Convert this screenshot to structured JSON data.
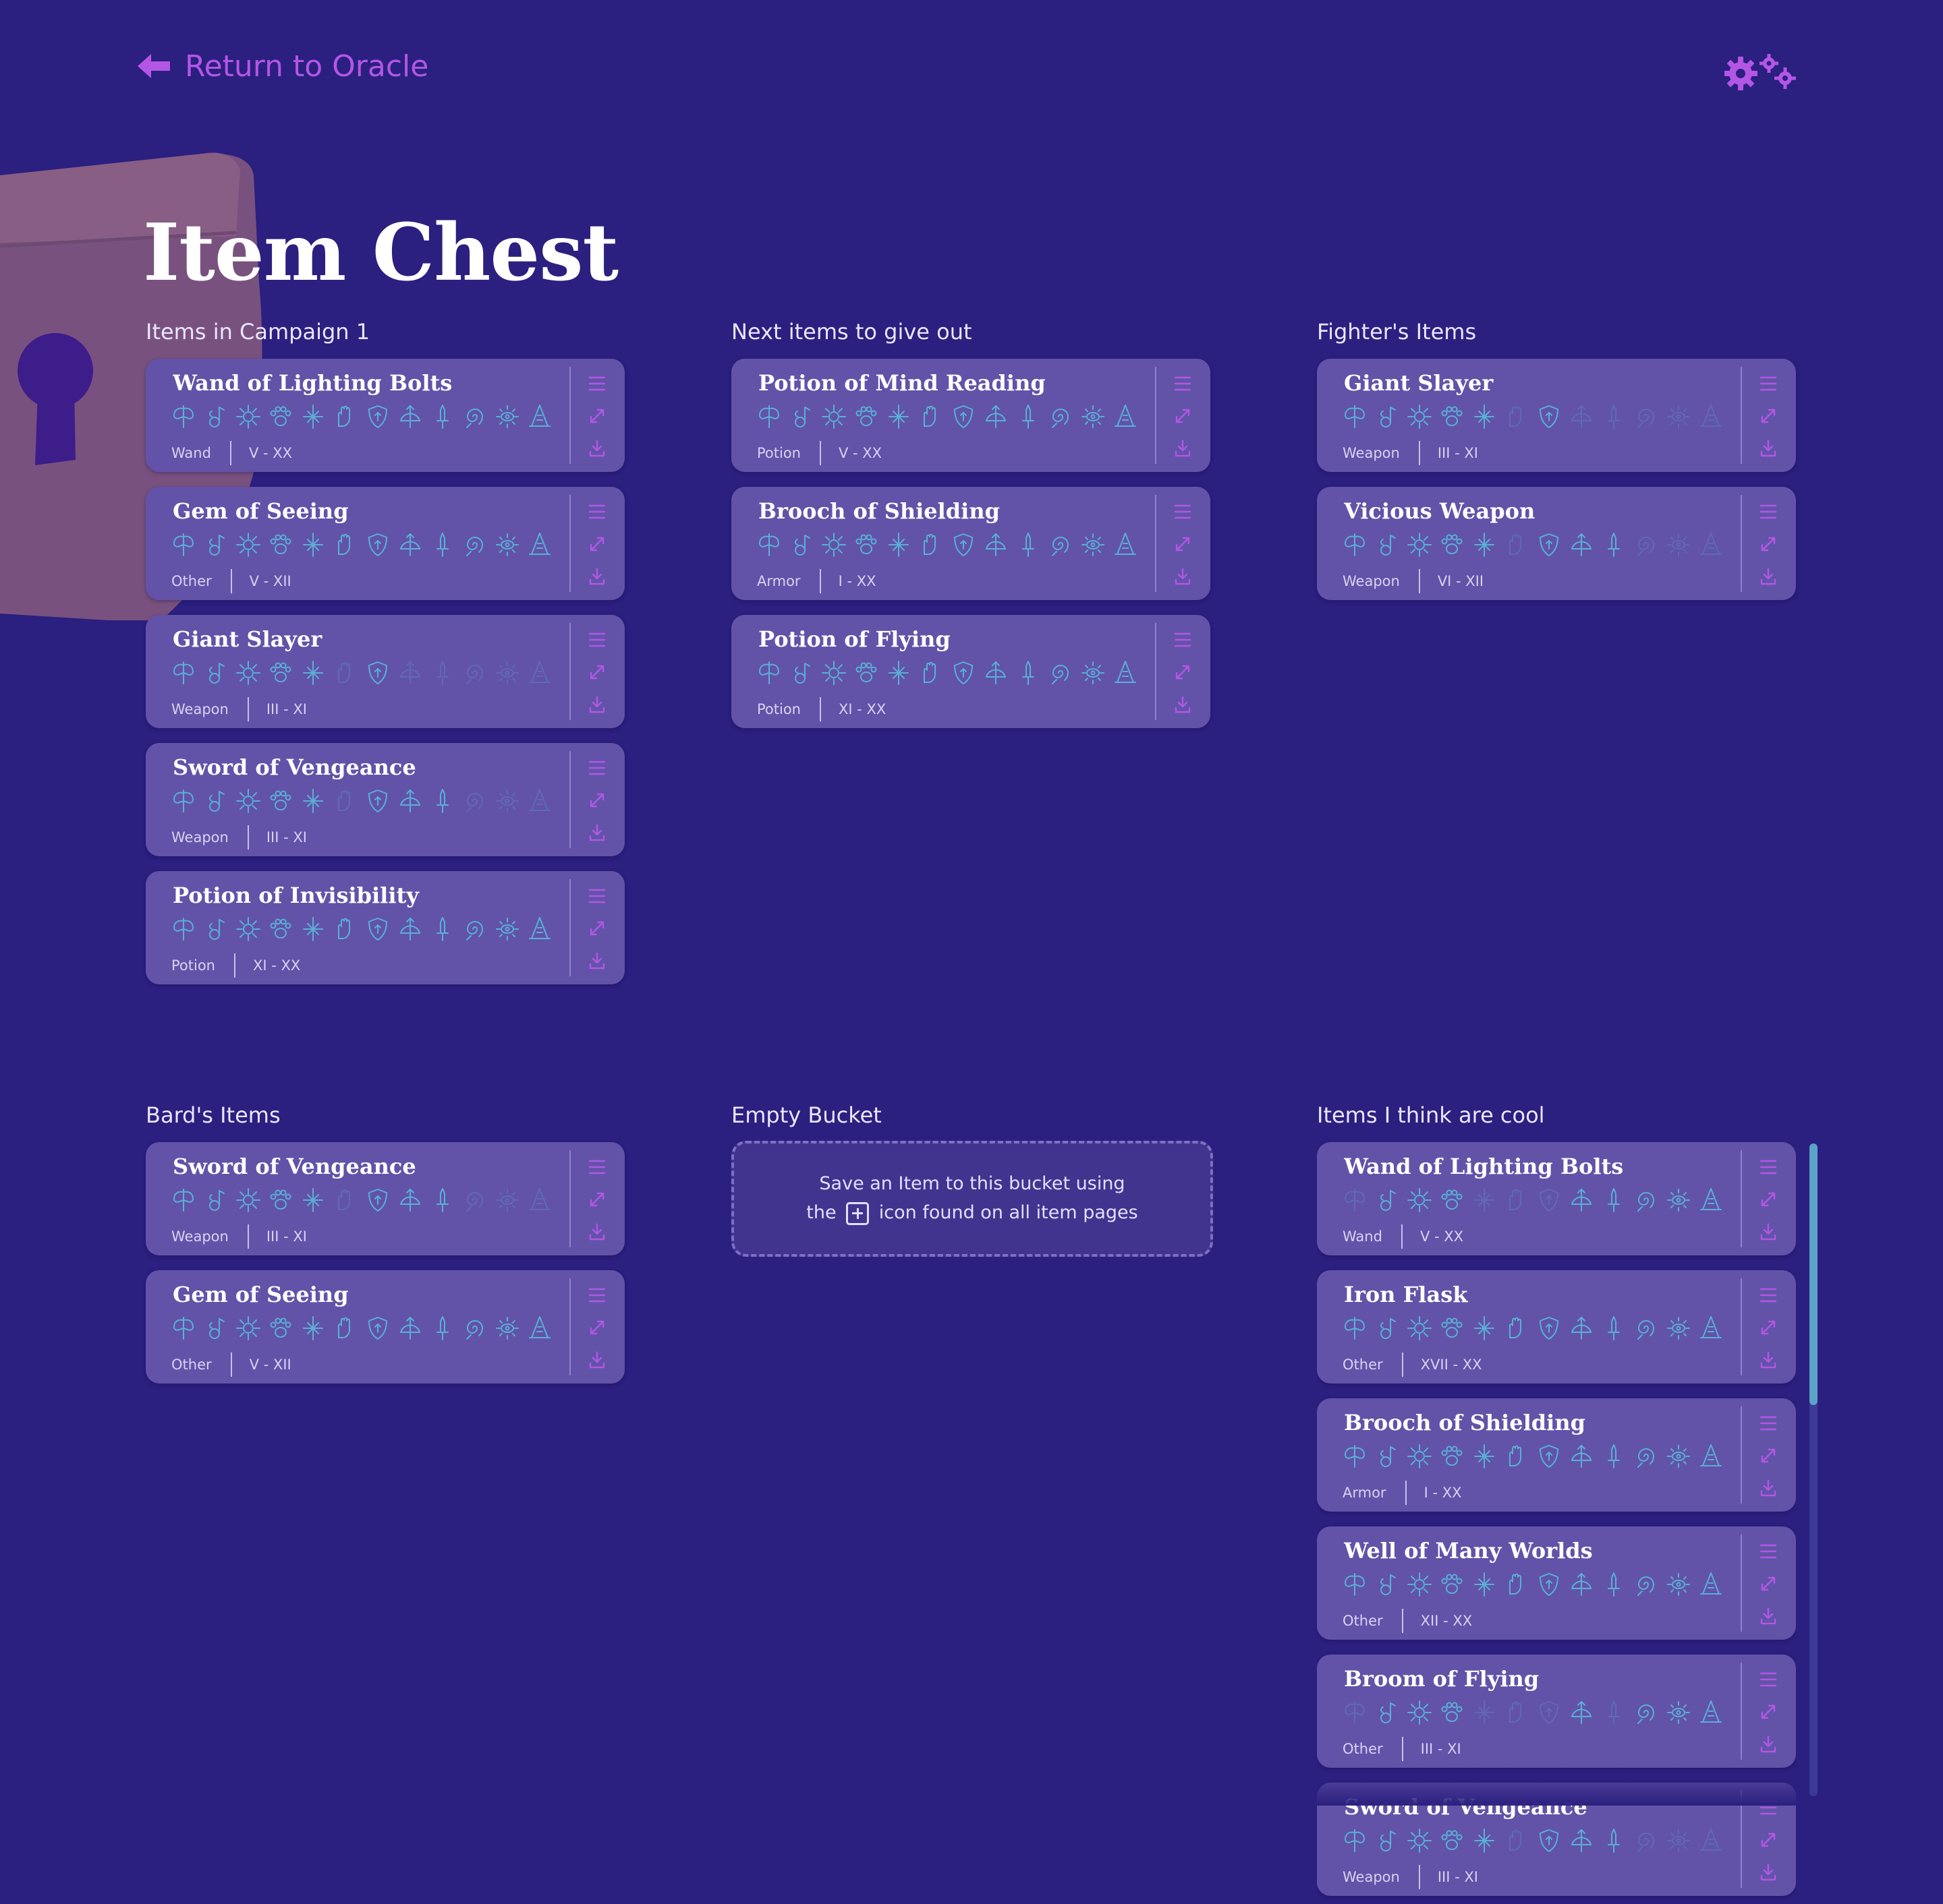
{
  "nav": {
    "back_label": "Return to Oracle"
  },
  "page": {
    "title": "Item Chest"
  },
  "empty_bucket": {
    "line1": "Save an Item to this bucket using",
    "line2_before": "the",
    "line2_after": "icon found on all item pages"
  },
  "class_icons": [
    "barbarian-icon",
    "bard-icon",
    "cleric-icon",
    "druid-icon",
    "fighter-icon",
    "monk-icon",
    "paladin-icon",
    "ranger-icon",
    "rogue-icon",
    "sorcerer-icon",
    "warlock-icon",
    "wizard-icon"
  ],
  "colors": {
    "background": "#2b1f7f",
    "card": "#6253a8",
    "accent": "#b356e6",
    "class_icon": "#5ab0d6"
  },
  "buckets": [
    {
      "title": "Items in Campaign 1",
      "items": [
        {
          "name": "Wand of Lighting Bolts",
          "type": "Wand",
          "levels": "V - XX",
          "classes": [
            1,
            1,
            1,
            1,
            1,
            1,
            1,
            1,
            1,
            1,
            1,
            1
          ]
        },
        {
          "name": "Gem of Seeing",
          "type": "Other",
          "levels": "V - XII",
          "classes": [
            1,
            1,
            1,
            1,
            1,
            1,
            1,
            1,
            1,
            1,
            1,
            1
          ]
        },
        {
          "name": "Giant Slayer",
          "type": "Weapon",
          "levels": "III - XI",
          "classes": [
            1,
            1,
            1,
            1,
            1,
            0,
            1,
            0,
            0,
            0,
            0,
            0
          ]
        },
        {
          "name": "Sword of Vengeance",
          "type": "Weapon",
          "levels": "III - XI",
          "classes": [
            1,
            1,
            1,
            1,
            1,
            0,
            1,
            1,
            1,
            0,
            0,
            0
          ]
        },
        {
          "name": "Potion of Invisibility",
          "type": "Potion",
          "levels": "XI - XX",
          "classes": [
            1,
            1,
            1,
            1,
            1,
            1,
            1,
            1,
            1,
            1,
            1,
            1
          ]
        }
      ]
    },
    {
      "title": "Next items to give out",
      "items": [
        {
          "name": "Potion of Mind Reading",
          "type": "Potion",
          "levels": "V - XX",
          "classes": [
            1,
            1,
            1,
            1,
            1,
            1,
            1,
            1,
            1,
            1,
            1,
            1
          ]
        },
        {
          "name": "Brooch of Shielding",
          "type": "Armor",
          "levels": "I - XX",
          "classes": [
            1,
            1,
            1,
            1,
            1,
            1,
            1,
            1,
            1,
            1,
            1,
            1
          ]
        },
        {
          "name": "Potion of Flying",
          "type": "Potion",
          "levels": "XI - XX",
          "classes": [
            1,
            1,
            1,
            1,
            1,
            1,
            1,
            1,
            1,
            1,
            1,
            1
          ]
        }
      ]
    },
    {
      "title": "Fighter's Items",
      "items": [
        {
          "name": "Giant Slayer",
          "type": "Weapon",
          "levels": "III - XI",
          "classes": [
            1,
            1,
            1,
            1,
            1,
            0,
            1,
            0,
            0,
            0,
            0,
            0
          ]
        },
        {
          "name": "Vicious Weapon",
          "type": "Weapon",
          "levels": "VI - XII",
          "classes": [
            1,
            1,
            1,
            1,
            1,
            0,
            1,
            1,
            1,
            0,
            0,
            0
          ]
        }
      ]
    },
    {
      "title": "Bard's Items",
      "items": [
        {
          "name": "Sword of Vengeance",
          "type": "Weapon",
          "levels": "III - XI",
          "classes": [
            1,
            1,
            1,
            1,
            1,
            0,
            1,
            1,
            1,
            0,
            0,
            0
          ]
        },
        {
          "name": "Gem of Seeing",
          "type": "Other",
          "levels": "V - XII",
          "classes": [
            1,
            1,
            1,
            1,
            1,
            1,
            1,
            1,
            1,
            1,
            1,
            1
          ]
        }
      ]
    },
    {
      "title": "Empty Bucket",
      "items": []
    },
    {
      "title": "Items I think are cool",
      "items": [
        {
          "name": "Wand of Lighting Bolts",
          "type": "Wand",
          "levels": "V - XX",
          "classes": [
            0,
            1,
            1,
            1,
            0,
            0,
            0,
            1,
            1,
            1,
            1,
            1
          ]
        },
        {
          "name": "Iron Flask",
          "type": "Other",
          "levels": "XVII - XX",
          "classes": [
            1,
            1,
            1,
            1,
            1,
            1,
            1,
            1,
            1,
            1,
            1,
            1
          ]
        },
        {
          "name": "Brooch of Shielding",
          "type": "Armor",
          "levels": "I - XX",
          "classes": [
            1,
            1,
            1,
            1,
            1,
            1,
            1,
            1,
            1,
            1,
            1,
            1
          ]
        },
        {
          "name": "Well of Many Worlds",
          "type": "Other",
          "levels": "XII - XX",
          "classes": [
            1,
            1,
            1,
            1,
            1,
            1,
            1,
            1,
            1,
            1,
            1,
            1
          ]
        },
        {
          "name": "Broom of Flying",
          "type": "Other",
          "levels": "III - XI",
          "classes": [
            0,
            1,
            1,
            1,
            0,
            0,
            0,
            1,
            0,
            1,
            1,
            1
          ]
        },
        {
          "name": "Sword of Vengeance",
          "type": "Weapon",
          "levels": "III - XI",
          "classes": [
            1,
            1,
            1,
            1,
            1,
            0,
            1,
            1,
            1,
            0,
            0,
            0
          ]
        }
      ]
    }
  ]
}
